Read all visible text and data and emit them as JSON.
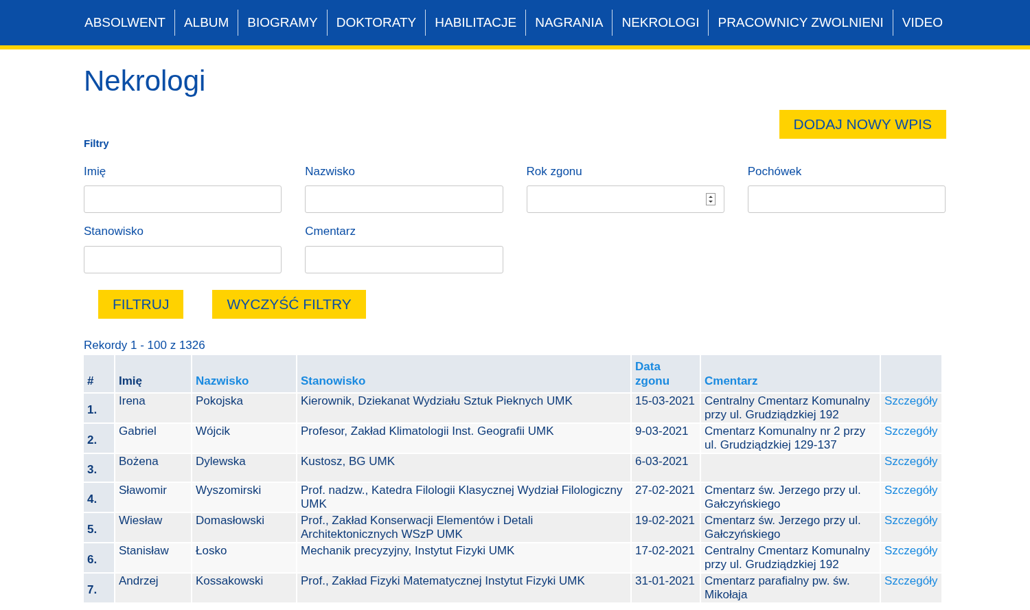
{
  "nav": [
    {
      "label": "ABSOLWENT"
    },
    {
      "label": "ALBUM"
    },
    {
      "label": "BIOGRAMY"
    },
    {
      "label": "DOKTORATY"
    },
    {
      "label": "HABILITACJE"
    },
    {
      "label": "NAGRANIA"
    },
    {
      "label": "NEKROLOGI"
    },
    {
      "label": "PRACOWNICY ZWOLNIENI"
    },
    {
      "label": "VIDEO"
    }
  ],
  "title": "Nekrologi",
  "add_button": "DODAJ NOWY WPIS",
  "filters_heading": "Filtry",
  "filters": [
    {
      "label": "Imię",
      "kind": "text"
    },
    {
      "label": "Nazwisko",
      "kind": "text"
    },
    {
      "label": "Rok zgonu",
      "kind": "number"
    },
    {
      "label": "Pochówek",
      "kind": "text"
    },
    {
      "label": "Stanowisko",
      "kind": "text"
    },
    {
      "label": "Cmentarz",
      "kind": "text"
    }
  ],
  "buttons": [
    "FILTRUJ",
    "WYCZYŚĆ FILTRY"
  ],
  "records": "Rekordy 1 - 100 z 1326",
  "table": {
    "columns": [
      {
        "label": "#",
        "kind": "plain"
      },
      {
        "label": "Imię",
        "kind": "sort",
        "selected": true
      },
      {
        "label": "Nazwisko",
        "kind": "sort",
        "selected": false
      },
      {
        "label": "Stanowisko",
        "kind": "sort",
        "selected": false
      },
      {
        "label": "Data zgonu",
        "kind": "sort",
        "selected": false
      },
      {
        "label": "Cmentarz",
        "kind": "sort",
        "selected": false
      }
    ],
    "rows": [
      {
        "number": "1.",
        "first_name": "Irena",
        "last_name": "Pokojska",
        "position": "Kierownik, Dziekanat Wydziału Sztuk Pieknych UMK",
        "date": "15-03-2021",
        "cemetery": "Centralny Cmentarz Komunalny przy ul. Grudziądzkiej 192",
        "link": "Szczegóły"
      },
      {
        "number": "2.",
        "first_name": "Gabriel",
        "last_name": "Wójcik",
        "position": "Profesor, Zakład Klimatologii Inst. Geografii UMK",
        "date": "9-03-2021",
        "cemetery": "Cmentarz Komunalny nr 2 przy ul. Grudziądzkiej 129-137",
        "link": "Szczegóły"
      },
      {
        "number": "3.",
        "first_name": "Bożena",
        "last_name": "Dylewska",
        "position": "Kustosz, BG UMK",
        "date": "6-03-2021",
        "link": "Szczegóły"
      },
      {
        "number": "4.",
        "first_name": "Sławomir",
        "last_name": "Wyszomirski",
        "position": "Prof. nadzw., Katedra Filologii Klasycznej Wydział Filologiczny UMK",
        "date": "27-02-2021",
        "cemetery": "Cmentarz św. Jerzego przy ul. Gałczyńskiego",
        "link": "Szczegóły"
      },
      {
        "number": "5.",
        "first_name": "Wiesław",
        "last_name": "Domasłowski",
        "position": "Prof., Zakład Konserwacji Elementów i Detali Architektonicznych WSzP UMK",
        "date": "19-02-2021",
        "cemetery": "Cmentarz św. Jerzego przy ul. Gałczyńskiego",
        "link": "Szczegóły"
      },
      {
        "number": "6.",
        "first_name": "Stanisław",
        "last_name": "Łosko",
        "position": "Mechanik precyzyjny, Instytut Fizyki UMK",
        "date": "17-02-2021",
        "cemetery": "Centralny Cmentarz Komunalny przy ul. Grudziądzkiej 192",
        "link": "Szczegóły"
      },
      {
        "number": "7.",
        "first_name": "Andrzej",
        "last_name": "Kossakowski",
        "position": "Prof., Zakład Fizyki Matematycznej Instytut Fizyki UMK",
        "date": "31-01-2021",
        "cemetery": "Cmentarz parafialny pw. św. Mikołaja",
        "link": "Szczegóły"
      }
    ]
  }
}
